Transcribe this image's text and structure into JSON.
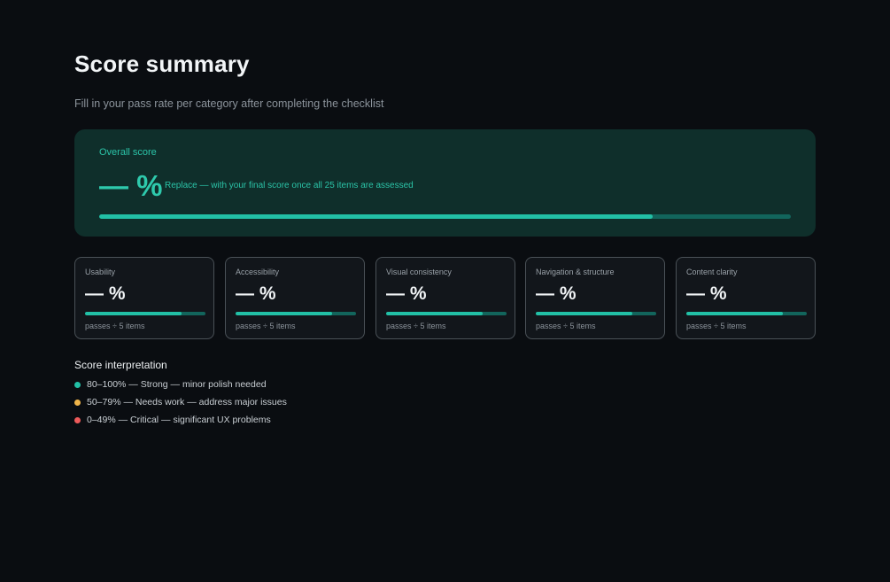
{
  "page": {
    "title": "Score summary",
    "subtitle": "Fill in your pass rate per category after completing the checklist"
  },
  "overall": {
    "label": "Overall score",
    "value": "— %",
    "note": "Replace — with your final score once all 25 items are assessed",
    "bar_fraction": 0.8,
    "colors": {
      "fill": "#22c0a6",
      "track": "#12655c",
      "bg": "#0f2f2b"
    }
  },
  "categories": [
    {
      "label": "Usability",
      "value": "— %",
      "footnote": "passes ÷ 5 items",
      "bar_fraction": 0.8
    },
    {
      "label": "Accessibility",
      "value": "— %",
      "footnote": "passes ÷ 5 items",
      "bar_fraction": 0.8
    },
    {
      "label": "Visual consistency",
      "value": "— %",
      "footnote": "passes ÷ 5 items",
      "bar_fraction": 0.8
    },
    {
      "label": "Navigation & structure",
      "value": "— %",
      "footnote": "passes ÷ 5 items",
      "bar_fraction": 0.8
    },
    {
      "label": "Content clarity",
      "value": "— %",
      "footnote": "passes ÷ 5 items",
      "bar_fraction": 0.8
    }
  ],
  "interpretation": {
    "title": "Score interpretation",
    "items": [
      {
        "text": "80–100%  —  Strong — minor polish needed",
        "color": "#22c0a6"
      },
      {
        "text": "50–79%  —  Needs work — address major issues",
        "color": "#f0b54a"
      },
      {
        "text": "0–49%  —  Critical — significant UX problems",
        "color": "#ee5a5a"
      }
    ]
  }
}
